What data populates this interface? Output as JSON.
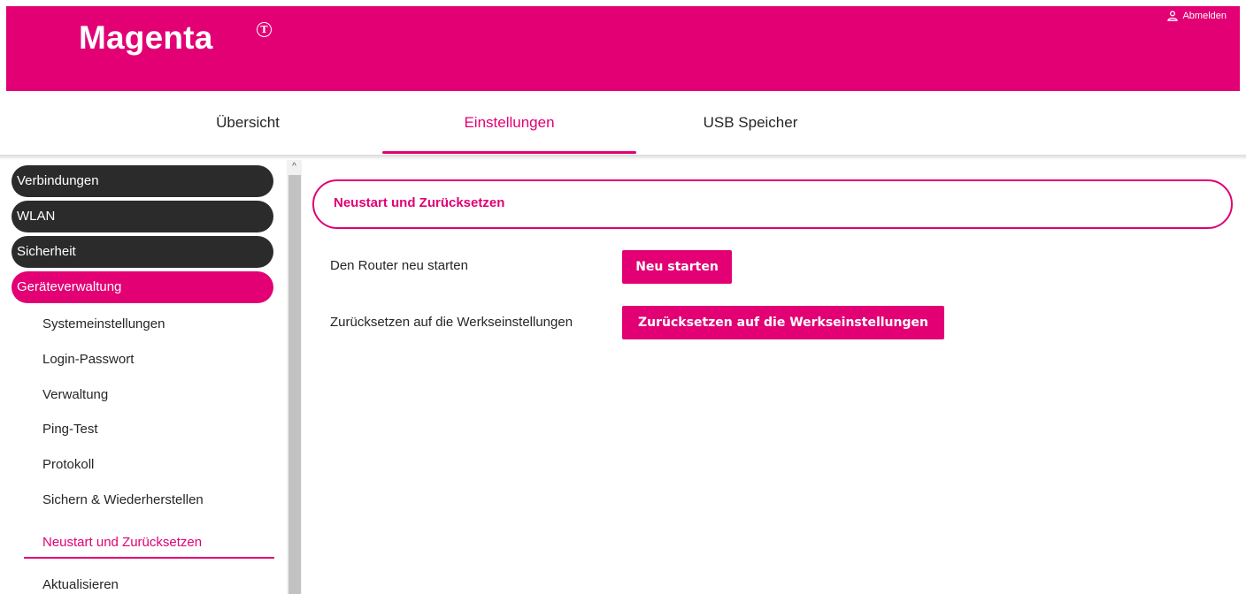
{
  "header": {
    "brand": "Magenta",
    "brand_mark": "T",
    "logout_label": "Abmelden",
    "logout_icon": "user-icon",
    "color": "#e20074"
  },
  "tabs": [
    {
      "label": "Übersicht",
      "active": false
    },
    {
      "label": "Einstellungen",
      "active": true
    },
    {
      "label": "USB Speicher",
      "active": false
    }
  ],
  "sidebar": {
    "categories": [
      {
        "label": "Verbindungen"
      },
      {
        "label": "WLAN"
      },
      {
        "label": "Sicherheit"
      },
      {
        "label": "Geräteverwaltung",
        "active": true
      }
    ],
    "items": [
      {
        "label": "Systemeinstellungen"
      },
      {
        "label": "Login-Passwort"
      },
      {
        "label": "Verwaltung"
      },
      {
        "label": "Ping-Test"
      },
      {
        "label": "Protokoll"
      },
      {
        "label": "Sichern & Wiederherstellen"
      },
      {
        "label": "Neustart und Zurücksetzen",
        "active": true
      },
      {
        "label": "Aktualisieren"
      }
    ],
    "scroll_up_glyph": "^"
  },
  "main": {
    "section_title": "Neustart und Zurücksetzen",
    "rows": [
      {
        "label": "Den Router neu starten",
        "button": "Neu starten"
      },
      {
        "label": "Zurücksetzen auf die Werkseinstellungen",
        "button": "Zurücksetzen auf die Werkseinstellungen"
      }
    ]
  }
}
